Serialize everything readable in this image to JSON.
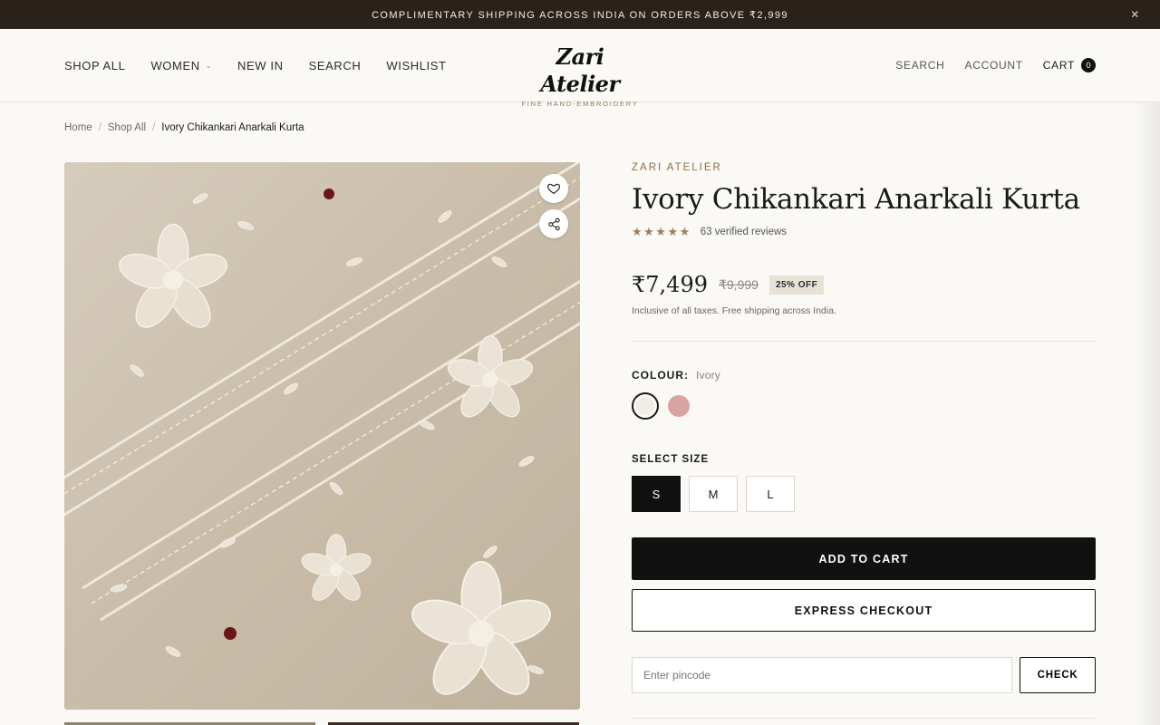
{
  "announcement": {
    "text": "COMPLIMENTARY SHIPPING ACROSS INDIA ON ORDERS ABOVE ₹2,999",
    "close_icon": "close-icon"
  },
  "header": {
    "nav_left": [
      "SHOP ALL",
      "WOMEN",
      "NEW IN",
      "SEARCH",
      "WISHLIST"
    ],
    "logo": {
      "script": "Zari Atelier",
      "tagline": "FINE HAND-EMBROIDERY"
    },
    "nav_right": {
      "search": "SEARCH",
      "account": "ACCOUNT",
      "cart": "CART",
      "cart_count": "0"
    }
  },
  "breadcrumb": {
    "home": "Home",
    "shop_all": "Shop All",
    "current": "Ivory Chikankari Anarkali Kurta"
  },
  "gallery": {
    "wishlist_icon": "heart-icon",
    "share_icon": "share-icon",
    "thumbnail_count": 2
  },
  "product": {
    "brand": "ZARI ATELIER",
    "title": "Ivory Chikankari Anarkali Kurta",
    "rating": 5,
    "stars": "★★★★★",
    "reviews": "63 verified reviews",
    "price": "₹7,499",
    "compare_price": "₹9,999",
    "discount": "25% OFF",
    "tax_note": "Inclusive of all taxes. Free shipping across India.",
    "colour_label": "COLOUR:",
    "colour_value": "Ivory",
    "colours": [
      {
        "name": "Ivory",
        "hex": "#f1ede4",
        "selected": true
      },
      {
        "name": "Rose",
        "hex": "#d9a3a3",
        "selected": false
      }
    ],
    "size_label": "SELECT SIZE",
    "sizes": [
      {
        "label": "S",
        "selected": true
      },
      {
        "label": "M",
        "selected": false
      },
      {
        "label": "L",
        "selected": false
      }
    ],
    "add_to_cart": "ADD TO CART",
    "express_checkout": "EXPRESS CHECKOUT",
    "pincode_placeholder": "Enter pincode",
    "check": "CHECK"
  },
  "colors": {
    "announcement_bg": "#2a211a",
    "brand_accent": "#8b6f45",
    "primary_button": "#111111",
    "page_bg": "#faf9f6"
  }
}
